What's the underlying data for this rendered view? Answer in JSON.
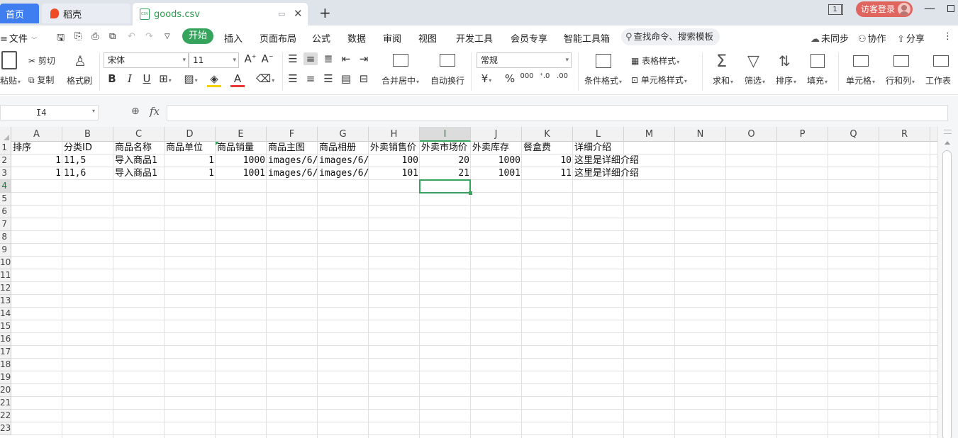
{
  "tabs": {
    "home": "首页",
    "daoke": "稻壳",
    "file": "goods.csv",
    "file_badge": "CSV"
  },
  "titlebar": {
    "window_count": "1",
    "login": "访客登录"
  },
  "menu": {
    "file": "文件",
    "start": "开始",
    "items": [
      "插入",
      "页面布局",
      "公式",
      "数据",
      "审阅",
      "视图",
      "开发工具",
      "会员专享",
      "智能工具箱"
    ],
    "search_placeholder": "查找命令、搜索模板",
    "sync": "未同步",
    "collab": "协作",
    "share": "分享"
  },
  "ribbon": {
    "paste": "粘贴",
    "cut": "剪切",
    "copy": "复制",
    "format_painter": "格式刷",
    "font_name": "宋体",
    "font_size": "11",
    "merge_center": "合并居中",
    "wrap_text": "自动换行",
    "number_format": "常规",
    "conditional_format": "条件格式",
    "table_style": "表格样式",
    "cell_style": "单元格样式",
    "sum": "求和",
    "filter": "筛选",
    "sort": "排序",
    "fill": "填充",
    "cells": "单元格",
    "row_col": "行和列",
    "worksheet": "工作表"
  },
  "formula_bar": {
    "name_box": "I4",
    "fx": "fx",
    "formula": ""
  },
  "sheet": {
    "columns": [
      "A",
      "B",
      "C",
      "D",
      "E",
      "F",
      "G",
      "H",
      "I",
      "J",
      "K",
      "L",
      "M",
      "N",
      "O",
      "P",
      "Q",
      "R"
    ],
    "rows": [
      "1",
      "2",
      "3",
      "4",
      "5",
      "6",
      "7",
      "8",
      "9",
      "10",
      "11",
      "12",
      "13",
      "14",
      "15",
      "16",
      "17",
      "18",
      "19",
      "20",
      "21",
      "22",
      "23"
    ],
    "selected_cell": "I4",
    "data": [
      [
        "排序",
        "分类ID",
        "商品名称",
        "商品单位",
        "商品销量",
        "商品主图",
        "商品相册",
        "外卖销售价",
        "外卖市场价",
        "外卖库存",
        "餐盒费",
        "详细介绍"
      ],
      [
        "1",
        "11,5",
        "导入商品1",
        "1",
        "1000",
        "images/6/",
        "images/6/",
        "100",
        "20",
        "1000",
        "10",
        "这里是详细介绍"
      ],
      [
        "1",
        "11,6",
        "导入商品1",
        "1",
        "1001",
        "images/6/",
        "images/6/",
        "101",
        "21",
        "1001",
        "11",
        "这里是详细介绍"
      ]
    ]
  },
  "colors": {
    "accent": "#37a45e",
    "home_tab": "#3f7ef0",
    "login": "#e0655e"
  }
}
